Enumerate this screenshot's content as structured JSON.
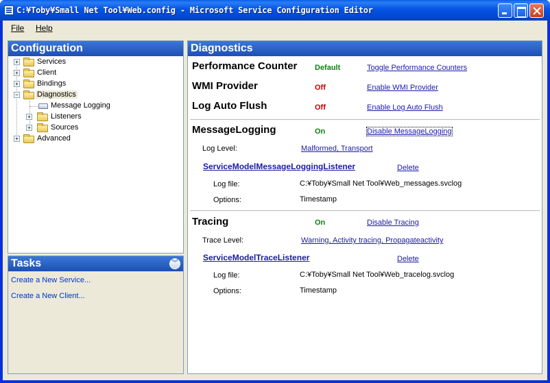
{
  "window": {
    "title": "C:¥Toby¥Small Net Tool¥Web.config - Microsoft Service Configuration Editor"
  },
  "menu": {
    "file": "File",
    "help": "Help"
  },
  "config_panel": {
    "header": "Configuration",
    "tree": {
      "services": "Services",
      "client": "Client",
      "bindings": "Bindings",
      "diagnostics": "Diagnostics",
      "message_logging": "Message Logging",
      "listeners": "Listeners",
      "sources": "Sources",
      "advanced": "Advanced"
    }
  },
  "tasks_panel": {
    "header": "Tasks",
    "links": [
      "Create a New Service...",
      "Create a New Client..."
    ]
  },
  "diag_panel": {
    "header": "Diagnostics",
    "perf_counter": {
      "title": "Performance Counter",
      "status": "Default",
      "link": "Toggle Performance Counters"
    },
    "wmi": {
      "title": "WMI Provider",
      "status": "Off",
      "link": "Enable WMI Provider"
    },
    "log_auto_flush": {
      "title": "Log Auto Flush",
      "status": "Off",
      "link": "Enable Log Auto Flush"
    },
    "message_logging": {
      "title": "MessageLogging",
      "status": "On",
      "link": "Disable MessageLogging",
      "log_level_label": "Log Level:",
      "log_level_value": "Malformed, Transport",
      "listener_name": "ServiceModelMessageLoggingListener",
      "delete": "Delete",
      "log_file_label": "Log file:",
      "log_file_value": "C:¥Toby¥Small Net Tool¥Web_messages.svclog",
      "options_label": "Options:",
      "options_value": "Timestamp"
    },
    "tracing": {
      "title": "Tracing",
      "status": "On",
      "link": "Disable Tracing",
      "trace_level_label": "Trace Level:",
      "trace_level_value": "Warning, Activity tracing, Propagateactivity",
      "listener_name": "ServiceModelTraceListener",
      "delete": "Delete",
      "log_file_label": "Log file:",
      "log_file_value": "C:¥Toby¥Small Net Tool¥Web_tracelog.svclog",
      "options_label": "Options:",
      "options_value": "Timestamp"
    }
  }
}
